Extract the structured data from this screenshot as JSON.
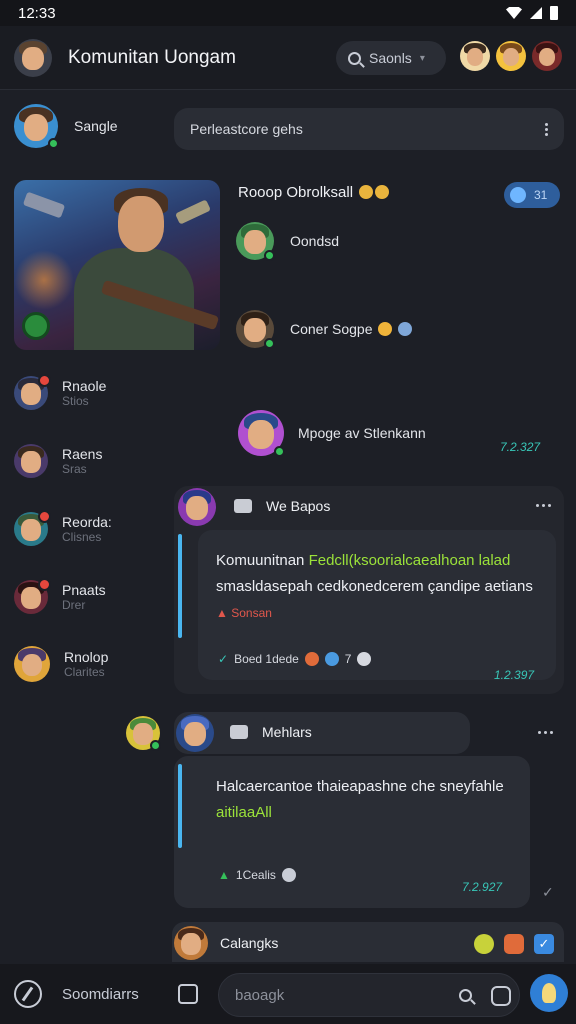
{
  "status": {
    "time": "12:33"
  },
  "header": {
    "title": "Komunitan Uongam",
    "search_label": "Saonls"
  },
  "sidebar": {
    "items": [
      {
        "label": "Sangle",
        "sub": ""
      },
      {
        "label": "Rnaole",
        "sub": "Stios"
      },
      {
        "label": "Raens",
        "sub": "Sras"
      },
      {
        "label": "Reorda:",
        "sub": "Clisnes"
      },
      {
        "label": "Pnaats",
        "sub": "Drer"
      },
      {
        "label": "Rnolop",
        "sub": "Clarites"
      }
    ]
  },
  "topic": {
    "text": "Perleastcore gehs"
  },
  "chat": {
    "title": "Rooop Obrolksall",
    "pin_count": "31",
    "members": [
      {
        "name": "Oondsd"
      },
      {
        "name": "Coner Sogpe"
      },
      {
        "name": "Mpoge av Stlenkann"
      }
    ],
    "member_time": "7.2.327"
  },
  "messages": [
    {
      "sender": "We Bapos",
      "line1_prefix": "Komuunitnan ",
      "line1_link": "Fedcll(ksoorialcaealhoan lalad",
      "line2": "smasldasepah cedkonedcerem çandipe aetians",
      "note": "Sonsan",
      "reactions": "Boed 1dede",
      "reaction_count": "7",
      "time": "1.2.397"
    },
    {
      "sender": "Mehlars",
      "line1": "Halcaercantoe thaieapashne che sneyfahle",
      "link": "aitilaaAll",
      "reaction_label": "1Cealis",
      "time": "7.2.927"
    }
  ],
  "last_chat": {
    "label": "Calangks"
  },
  "bottom": {
    "left_label": "Soomdiarrs",
    "compose_placeholder": "baoagk"
  },
  "colors": {
    "accent_blue": "#2f7fd6",
    "link_green": "#9be23a",
    "timestamp_teal": "#38c7b8",
    "online_green": "#35c05a",
    "badge_red": "#e5473d"
  }
}
